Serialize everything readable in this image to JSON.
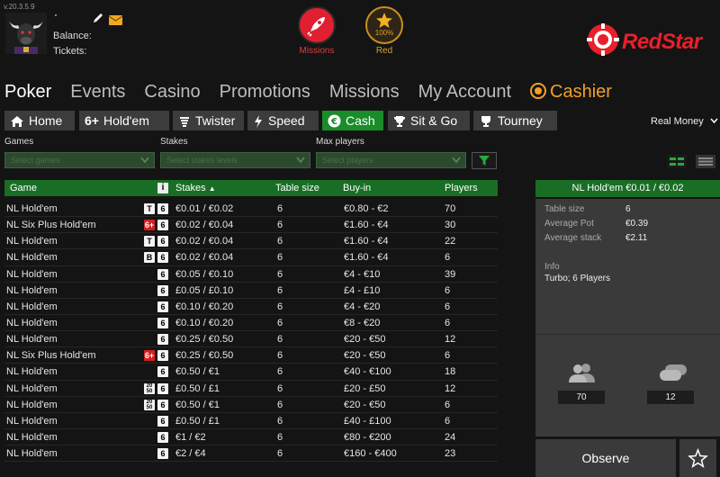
{
  "version": "v.20.3.5.9",
  "account": {
    "balance_label": "Balance:",
    "tickets_label": "Tickets:"
  },
  "top_icons": [
    {
      "caption": "Missions",
      "caption_color": "#e03c3c"
    },
    {
      "caption": "Red",
      "caption_color": "#d8a030",
      "progress": "100%"
    }
  ],
  "brand": {
    "name": "RedStar",
    "color": "#e8202b"
  },
  "main_nav": [
    "Poker",
    "Events",
    "Casino",
    "Promotions",
    "Missions",
    "My Account",
    "Cashier"
  ],
  "sub_tabs": [
    "Home",
    "Hold'em",
    "Twister",
    "Speed",
    "Cash",
    "Sit & Go",
    "Tourney"
  ],
  "sub_tab_prefix": "6+",
  "real_money": "Real Money",
  "filters": [
    {
      "label": "Games",
      "placeholder": "Select games"
    },
    {
      "label": "Stakes",
      "placeholder": "Select stakes levels"
    },
    {
      "label": "Max players",
      "placeholder": "Select players"
    }
  ],
  "table": {
    "headers": {
      "game": "Game",
      "info": "i",
      "stakes": "Stakes",
      "table_size": "Table size",
      "buyin": "Buy-in",
      "players": "Players"
    },
    "rows": [
      {
        "game": "NL Hold'em",
        "badges": [
          "T",
          "6"
        ],
        "stakes": "€0.01 / €0.02",
        "size": "6",
        "buyin": "€0.80 - €2",
        "players": "70"
      },
      {
        "game": "NL Six Plus Hold'em",
        "badges": [
          "6+",
          "6"
        ],
        "stakes": "€0.02 / €0.04",
        "size": "6",
        "buyin": "€1.60 - €4",
        "players": "30"
      },
      {
        "game": "NL Hold'em",
        "badges": [
          "T",
          "6"
        ],
        "stakes": "€0.02 / €0.04",
        "size": "6",
        "buyin": "€1.60 - €4",
        "players": "22"
      },
      {
        "game": "NL Hold'em",
        "badges": [
          "B",
          "6"
        ],
        "stakes": "€0.02 / €0.04",
        "size": "6",
        "buyin": "€1.60 - €4",
        "players": "6"
      },
      {
        "game": "NL Hold'em",
        "badges": [
          "6"
        ],
        "stakes": "€0.05 / €0.10",
        "size": "6",
        "buyin": "€4 - €10",
        "players": "39"
      },
      {
        "game": "NL Hold'em",
        "badges": [
          "6"
        ],
        "stakes": "£0.05 / £0.10",
        "size": "6",
        "buyin": "£4 - £10",
        "players": "6"
      },
      {
        "game": "NL Hold'em",
        "badges": [
          "6"
        ],
        "stakes": "€0.10 / €0.20",
        "size": "6",
        "buyin": "€4 - €20",
        "players": "6"
      },
      {
        "game": "NL Hold'em",
        "badges": [
          "6"
        ],
        "stakes": "€0.10 / €0.20",
        "size": "6",
        "buyin": "€8 - €20",
        "players": "6"
      },
      {
        "game": "NL Hold'em",
        "badges": [
          "6"
        ],
        "stakes": "€0.25 / €0.50",
        "size": "6",
        "buyin": "€20 - €50",
        "players": "12"
      },
      {
        "game": "NL Six Plus Hold'em",
        "badges": [
          "6+",
          "6"
        ],
        "stakes": "€0.25 / €0.50",
        "size": "6",
        "buyin": "€20 - €50",
        "players": "6"
      },
      {
        "game": "NL Hold'em",
        "badges": [
          "6"
        ],
        "stakes": "€0.50 / €1",
        "size": "6",
        "buyin": "€40 - €100",
        "players": "18"
      },
      {
        "game": "NL Hold'em",
        "badges": [
          "20/50",
          "6"
        ],
        "stakes": "£0.50 / £1",
        "size": "6",
        "buyin": "£20 - £50",
        "players": "12"
      },
      {
        "game": "NL Hold'em",
        "badges": [
          "20/50",
          "6"
        ],
        "stakes": "€0.50 / €1",
        "size": "6",
        "buyin": "€20 - €50",
        "players": "6"
      },
      {
        "game": "NL Hold'em",
        "badges": [
          "6"
        ],
        "stakes": "£0.50 / £1",
        "size": "6",
        "buyin": "£40 - £100",
        "players": "6"
      },
      {
        "game": "NL Hold'em",
        "badges": [
          "6"
        ],
        "stakes": "€1 / €2",
        "size": "6",
        "buyin": "€80 - €200",
        "players": "24"
      },
      {
        "game": "NL Hold'em",
        "badges": [
          "6"
        ],
        "stakes": "€2 / €4",
        "size": "6",
        "buyin": "€160 - €400",
        "players": "23"
      }
    ]
  },
  "panel": {
    "title": "NL Hold'em €0.01 / €0.02",
    "details": [
      {
        "key": "Table size",
        "value": "6"
      },
      {
        "key": "Average Pot",
        "value": "€0.39"
      },
      {
        "key": "Average stack",
        "value": "€2.11"
      }
    ],
    "info_label": "Info",
    "info_text": "Turbo; 6 Players",
    "players_count": "70",
    "tables_count": "12",
    "observe_label": "Observe"
  },
  "colors": {
    "accent_green": "#1a8c2a",
    "header_green": "#186e24",
    "cashier_orange": "#f0a028",
    "badge_red": "#d42020"
  }
}
